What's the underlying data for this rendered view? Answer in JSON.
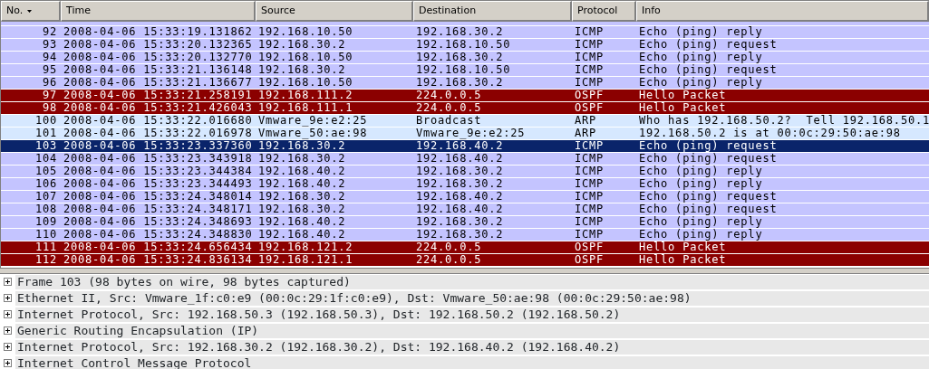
{
  "packet_list": {
    "columns": [
      {
        "label": "No.",
        "sorted": true
      },
      {
        "label": "Time",
        "sorted": false
      },
      {
        "label": "Source",
        "sorted": false
      },
      {
        "label": "Destination",
        "sorted": false
      },
      {
        "label": "Protocol",
        "sorted": false
      },
      {
        "label": "Info",
        "sorted": false
      }
    ],
    "rows": [
      {
        "no": "92",
        "time": "2008-04-06 15:33:19.131862",
        "source": "192.168.10.50",
        "destination": "192.168.30.2",
        "protocol": "ICMP",
        "info": "Echo (ping) reply",
        "kind": "icmp",
        "selected": false
      },
      {
        "no": "93",
        "time": "2008-04-06 15:33:20.132365",
        "source": "192.168.30.2",
        "destination": "192.168.10.50",
        "protocol": "ICMP",
        "info": "Echo (ping) request",
        "kind": "icmp",
        "selected": false
      },
      {
        "no": "94",
        "time": "2008-04-06 15:33:20.132770",
        "source": "192.168.10.50",
        "destination": "192.168.30.2",
        "protocol": "ICMP",
        "info": "Echo (ping) reply",
        "kind": "icmp",
        "selected": false
      },
      {
        "no": "95",
        "time": "2008-04-06 15:33:21.136148",
        "source": "192.168.30.2",
        "destination": "192.168.10.50",
        "protocol": "ICMP",
        "info": "Echo (ping) request",
        "kind": "icmp",
        "selected": false
      },
      {
        "no": "96",
        "time": "2008-04-06 15:33:21.136677",
        "source": "192.168.10.50",
        "destination": "192.168.30.2",
        "protocol": "ICMP",
        "info": "Echo (ping) reply",
        "kind": "icmp",
        "selected": false
      },
      {
        "no": "97",
        "time": "2008-04-06 15:33:21.258191",
        "source": "192.168.111.2",
        "destination": "224.0.0.5",
        "protocol": "OSPF",
        "info": "Hello Packet",
        "kind": "ospf",
        "selected": false
      },
      {
        "no": "98",
        "time": "2008-04-06 15:33:21.426043",
        "source": "192.168.111.1",
        "destination": "224.0.0.5",
        "protocol": "OSPF",
        "info": "Hello Packet",
        "kind": "ospf",
        "selected": false
      },
      {
        "no": "100",
        "time": "2008-04-06 15:33:22.016680",
        "source": "Vmware_9e:e2:25",
        "destination": "Broadcast",
        "protocol": "ARP",
        "info": "Who has 192.168.50.2?  Tell 192.168.50.1",
        "kind": "arp",
        "selected": false
      },
      {
        "no": "101",
        "time": "2008-04-06 15:33:22.016978",
        "source": "Vmware_50:ae:98",
        "destination": "Vmware_9e:e2:25",
        "protocol": "ARP",
        "info": "192.168.50.2 is at 00:0c:29:50:ae:98",
        "kind": "arp",
        "selected": false
      },
      {
        "no": "103",
        "time": "2008-04-06 15:33:23.337360",
        "source": "192.168.30.2",
        "destination": "192.168.40.2",
        "protocol": "ICMP",
        "info": "Echo (ping) request",
        "kind": "icmp",
        "selected": true
      },
      {
        "no": "104",
        "time": "2008-04-06 15:33:23.343918",
        "source": "192.168.30.2",
        "destination": "192.168.40.2",
        "protocol": "ICMP",
        "info": "Echo (ping) request",
        "kind": "icmp",
        "selected": false
      },
      {
        "no": "105",
        "time": "2008-04-06 15:33:23.344384",
        "source": "192.168.40.2",
        "destination": "192.168.30.2",
        "protocol": "ICMP",
        "info": "Echo (ping) reply",
        "kind": "icmp",
        "selected": false
      },
      {
        "no": "106",
        "time": "2008-04-06 15:33:23.344493",
        "source": "192.168.40.2",
        "destination": "192.168.30.2",
        "protocol": "ICMP",
        "info": "Echo (ping) reply",
        "kind": "icmp",
        "selected": false
      },
      {
        "no": "107",
        "time": "2008-04-06 15:33:24.348014",
        "source": "192.168.30.2",
        "destination": "192.168.40.2",
        "protocol": "ICMP",
        "info": "Echo (ping) request",
        "kind": "icmp",
        "selected": false
      },
      {
        "no": "108",
        "time": "2008-04-06 15:33:24.348171",
        "source": "192.168.30.2",
        "destination": "192.168.40.2",
        "protocol": "ICMP",
        "info": "Echo (ping) request",
        "kind": "icmp",
        "selected": false
      },
      {
        "no": "109",
        "time": "2008-04-06 15:33:24.348693",
        "source": "192.168.40.2",
        "destination": "192.168.30.2",
        "protocol": "ICMP",
        "info": "Echo (ping) reply",
        "kind": "icmp",
        "selected": false
      },
      {
        "no": "110",
        "time": "2008-04-06 15:33:24.348830",
        "source": "192.168.40.2",
        "destination": "192.168.30.2",
        "protocol": "ICMP",
        "info": "Echo (ping) reply",
        "kind": "icmp",
        "selected": false
      },
      {
        "no": "111",
        "time": "2008-04-06 15:33:24.656434",
        "source": "192.168.121.2",
        "destination": "224.0.0.5",
        "protocol": "OSPF",
        "info": "Hello Packet",
        "kind": "ospf",
        "selected": false
      },
      {
        "no": "112",
        "time": "2008-04-06 15:33:24.836134",
        "source": "192.168.121.1",
        "destination": "224.0.0.5",
        "protocol": "OSPF",
        "info": "Hello Packet",
        "kind": "ospf",
        "selected": false
      }
    ]
  },
  "packet_details": [
    {
      "text": "Frame 103 (98 bytes on wire, 98 bytes captured)",
      "expanded": false
    },
    {
      "text": "Ethernet II, Src: Vmware_1f:c0:e9 (00:0c:29:1f:c0:e9), Dst: Vmware_50:ae:98 (00:0c:29:50:ae:98)",
      "expanded": false
    },
    {
      "text": "Internet Protocol, Src: 192.168.50.3 (192.168.50.3), Dst: 192.168.50.2 (192.168.50.2)",
      "expanded": false
    },
    {
      "text": "Generic Routing Encapsulation (IP)",
      "expanded": false
    },
    {
      "text": "Internet Protocol, Src: 192.168.30.2 (192.168.30.2), Dst: 192.168.40.2 (192.168.40.2)",
      "expanded": false
    },
    {
      "text": "Internet Control Message Protocol",
      "expanded": false
    }
  ]
}
